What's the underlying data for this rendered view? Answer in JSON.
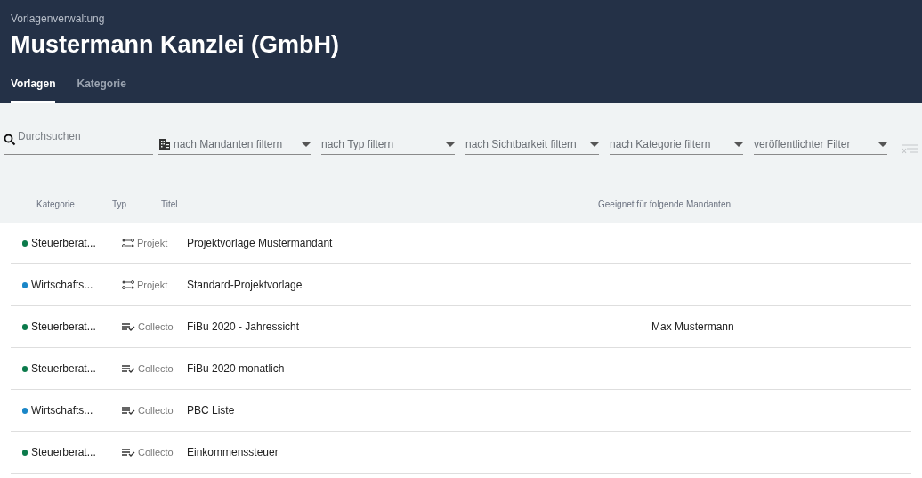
{
  "header": {
    "subtitle": "Vorlagenverwaltung",
    "title": "Mustermann Kanzlei (GmbH)"
  },
  "tabs": [
    {
      "label": "Vorlagen",
      "selected": true
    },
    {
      "label": "Kategorie",
      "selected": false
    }
  ],
  "search": {
    "placeholder": "Durchsuchen"
  },
  "filters": [
    {
      "placeholder": "nach Mandanten filtern",
      "kind": "building"
    },
    {
      "placeholder": "nach Typ filtern",
      "kind": "plain"
    },
    {
      "placeholder": "nach Sichtbarkeit filtern",
      "kind": "plain"
    },
    {
      "placeholder": "nach Kategorie filtern",
      "kind": "plain"
    },
    {
      "placeholder": "veröffentlichter Filter",
      "kind": "plain"
    }
  ],
  "table": {
    "columns": [
      "Kategorie",
      "Typ",
      "Titel",
      "Geeignet für folgende Mandanten"
    ],
    "rows": [
      {
        "category": "Steuerberat...",
        "color": "#0b7a4b",
        "type": "Projekt",
        "kind": "projekt",
        "title": "Projektvorlage Mustermandant"
      },
      {
        "category": "Wirtschafts...",
        "color": "#1a86c7",
        "type": "Projekt",
        "kind": "projekt",
        "title": "Standard-Projektvorlage"
      },
      {
        "category": "Steuerberat...",
        "color": "#0b7a4b",
        "type": "Collecto",
        "kind": "collecto",
        "title": "FiBu 2020 - Jahressicht",
        "clients": "Max Mustermann"
      },
      {
        "category": "Steuerberat...",
        "color": "#0b7a4b",
        "type": "Collecto",
        "kind": "collecto",
        "title": "FiBu 2020 monatlich"
      },
      {
        "category": "Wirtschafts...",
        "color": "#1a86c7",
        "type": "Collecto",
        "kind": "collecto",
        "title": "PBC Liste"
      },
      {
        "category": "Steuerberat...",
        "color": "#0b7a4b",
        "type": "Collecto",
        "kind": "collecto",
        "title": "Einkommenssteuer"
      }
    ]
  }
}
